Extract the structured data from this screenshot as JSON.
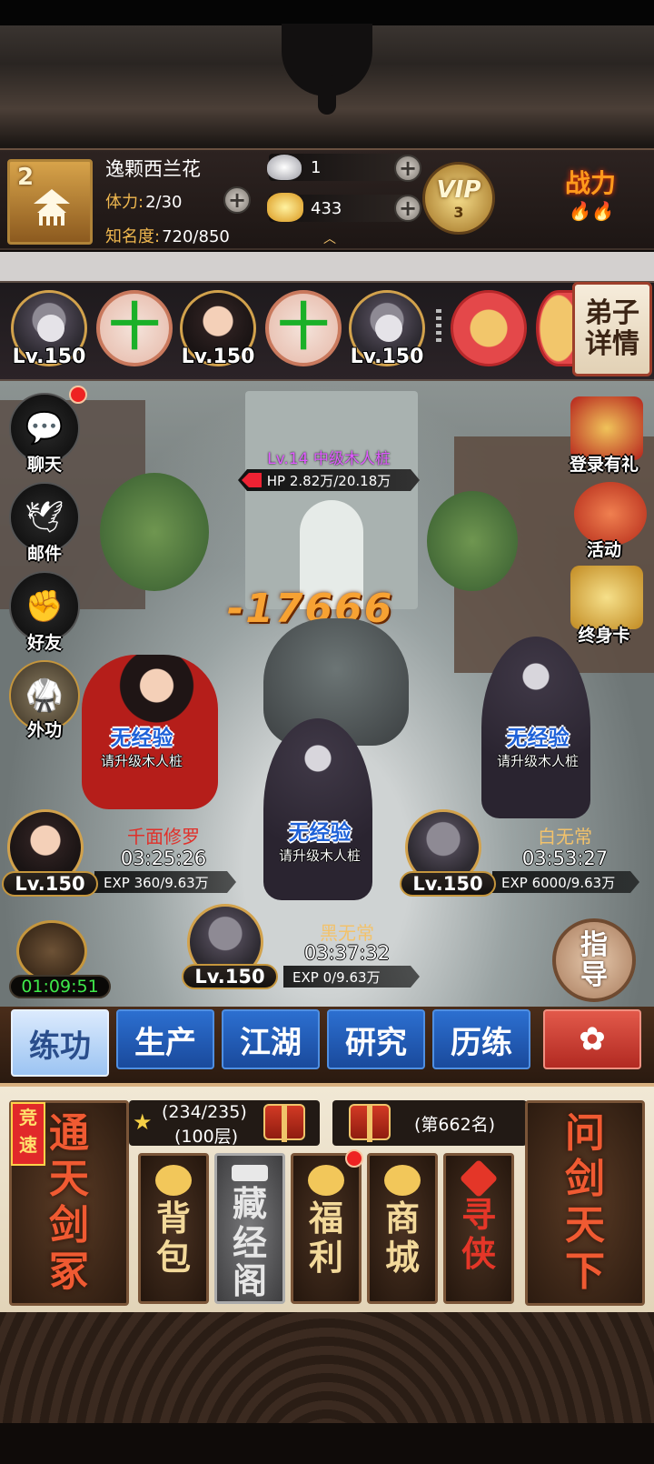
{
  "player": {
    "level": "2",
    "name": "逸颗西兰花",
    "stamina_label": "体力:",
    "stamina_value": "2/30",
    "fame_label": "知名度:",
    "fame_value": "720/850",
    "silver": "1",
    "gold": "433",
    "vip_label": "VIP",
    "vip_level": "3",
    "power_label": "战力"
  },
  "disciples": {
    "slots": [
      {
        "type": "avatar",
        "level": "Lv.150"
      },
      {
        "type": "add",
        "symbol": "十"
      },
      {
        "type": "avatar",
        "level": "Lv.150"
      },
      {
        "type": "add",
        "symbol": "十"
      },
      {
        "type": "avatar",
        "level": "Lv.150"
      }
    ],
    "detail_button": "弟子详情"
  },
  "side_left": [
    {
      "label": "聊天",
      "icon": "chat-icon"
    },
    {
      "label": "邮件",
      "icon": "mail-icon"
    },
    {
      "label": "好友",
      "icon": "friends-icon"
    },
    {
      "label": "外功",
      "icon": "martial-arts-icon"
    }
  ],
  "side_right": [
    {
      "label": "登录有礼",
      "icon": "login-gift-icon"
    },
    {
      "label": "活动",
      "icon": "event-icon"
    },
    {
      "label": "终身卡",
      "icon": "lifetime-card-icon"
    }
  ],
  "target": {
    "name": "Lv.14 中级木人桩",
    "hp": "HP 2.82万/20.18万",
    "damage": "-17666"
  },
  "no_exp": {
    "title": "无经验",
    "subtitle": "请升级木人桩"
  },
  "units": [
    {
      "name": "千面修罗",
      "time": "03:25:26",
      "level": "Lv.150",
      "exp": "EXP 360/9.63万",
      "name_color": "#e0302a"
    },
    {
      "name": "白无常",
      "time": "03:53:27",
      "level": "Lv.150",
      "exp": "EXP 6000/9.63万",
      "name_color": "#f2c26b"
    },
    {
      "name": "黑无常",
      "time": "03:37:32",
      "level": "Lv.150",
      "exp": "EXP 0/9.63万",
      "name_color": "#f2c26b"
    }
  ],
  "timer": "01:09:51",
  "guide_button": "指导",
  "tabs": [
    "练功",
    "生产",
    "江湖",
    "研究",
    "历练"
  ],
  "bottom": {
    "left_card": "通天剑冢",
    "left_badge": "竞速",
    "progress": "(234/235)",
    "floor": "(100层)",
    "rank": "(第662名)",
    "right_card": "问剑天下",
    "cards": [
      {
        "label": "背包",
        "style": "normal"
      },
      {
        "label": "藏经阁",
        "style": "grey"
      },
      {
        "label": "福利",
        "style": "normal"
      },
      {
        "label": "商城",
        "style": "normal"
      },
      {
        "label": "寻侠",
        "style": "red"
      }
    ]
  }
}
